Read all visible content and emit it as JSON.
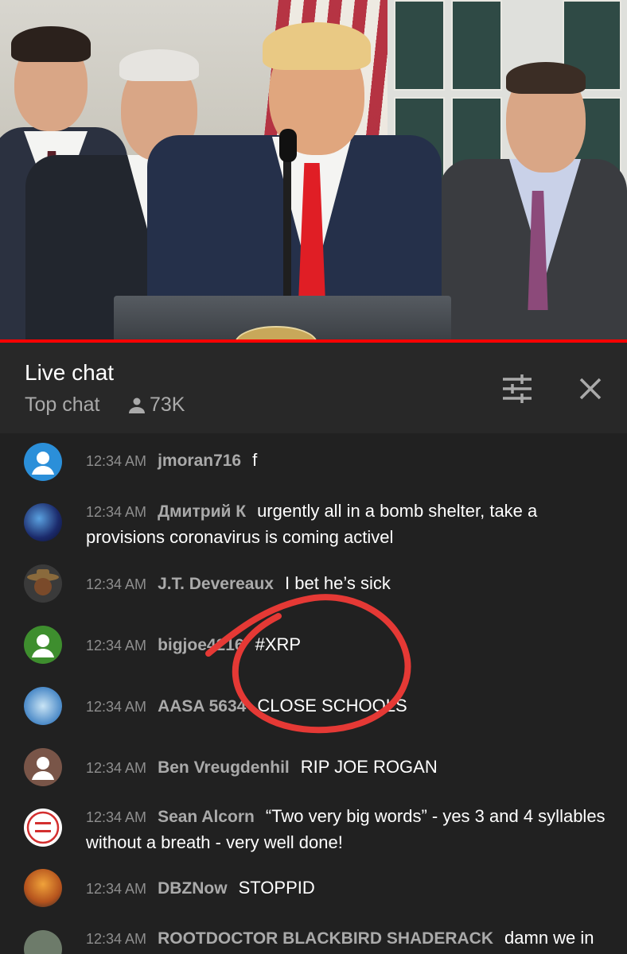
{
  "chat": {
    "title": "Live chat",
    "mode": "Top chat",
    "viewers": "73K"
  },
  "icons": {
    "viewers": "person-icon",
    "filter": "sliders-icon",
    "close": "close-icon"
  },
  "colors": {
    "background": "#212121",
    "header": "#282828",
    "progress": "#ff0000",
    "annotation": "#e53935"
  },
  "messages": [
    {
      "time": "12:34 AM",
      "author": "jmoran716",
      "text": "f"
    },
    {
      "time": "12:34 AM",
      "author": "Дмитрий К",
      "text": "urgently all in a bomb shelter, take a provisions coronavirus is coming activel"
    },
    {
      "time": "12:34 AM",
      "author": "J.T. Devereaux",
      "text": "I bet he’s sick"
    },
    {
      "time": "12:34 AM",
      "author": "bigjoe4216",
      "text": "#XRP"
    },
    {
      "time": "12:34 AM",
      "author": "AASA 5634",
      "text": "CLOSE SCHOOLS"
    },
    {
      "time": "12:34 AM",
      "author": "Ben Vreugdenhil",
      "text": "RIP JOE ROGAN"
    },
    {
      "time": "12:34 AM",
      "author": "Sean Alcorn",
      "text": "“Two very big words” - yes 3 and 4 syllables without a breath - very well done!"
    },
    {
      "time": "12:34 AM",
      "author": "DBZNow",
      "text": "STOPPID"
    },
    {
      "time": "12:34 AM",
      "author": "ROOTDOCTOR BLACKBIRD SHADERACK",
      "text": "damn we in"
    }
  ]
}
